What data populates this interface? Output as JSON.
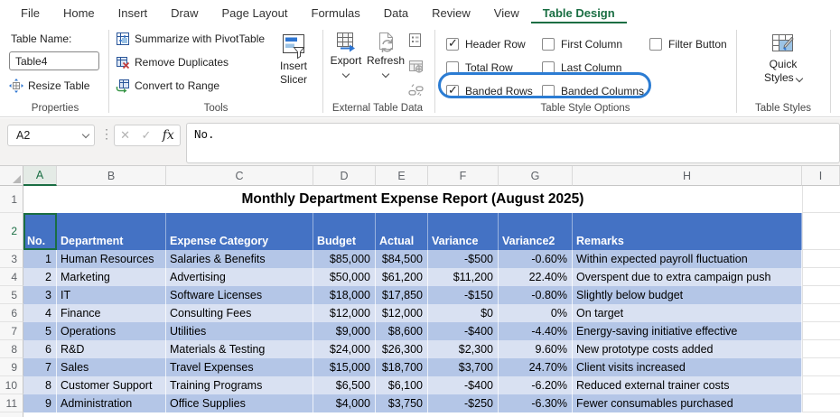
{
  "colors": {
    "accent_green": "#1a6e43",
    "header_fill": "#4472c4",
    "band_dark": "#b4c6e7",
    "band_light": "#d9e1f2",
    "highlight_ring": "#2b7cd3"
  },
  "ribbon": {
    "tabs": [
      {
        "label": "File",
        "active": false
      },
      {
        "label": "Home",
        "active": false
      },
      {
        "label": "Insert",
        "active": false
      },
      {
        "label": "Draw",
        "active": false
      },
      {
        "label": "Page Layout",
        "active": false
      },
      {
        "label": "Formulas",
        "active": false
      },
      {
        "label": "Data",
        "active": false
      },
      {
        "label": "Review",
        "active": false
      },
      {
        "label": "View",
        "active": false
      },
      {
        "label": "Table Design",
        "active": true
      }
    ],
    "properties": {
      "table_name_label": "Table Name:",
      "table_name_value": "Table4",
      "resize_table_label": "Resize Table",
      "group_label": "Properties"
    },
    "tools": {
      "items": [
        "Summarize with PivotTable",
        "Remove Duplicates",
        "Convert to Range"
      ],
      "insert_slicer_label": "Insert Slicer",
      "group_label": "Tools"
    },
    "external": {
      "export_label": "Export",
      "refresh_label": "Refresh",
      "group_label": "External Table Data"
    },
    "style_options": {
      "checkboxes": [
        {
          "label": "Header Row",
          "checked": true
        },
        {
          "label": "Total Row",
          "checked": false
        },
        {
          "label": "Banded Rows",
          "checked": true
        },
        {
          "label": "First Column",
          "checked": false
        },
        {
          "label": "Last Column",
          "checked": false
        },
        {
          "label": "Banded Columns",
          "checked": false
        },
        {
          "label": "Filter Button",
          "checked": false
        }
      ],
      "group_label": "Table Style Options"
    },
    "table_styles": {
      "quick_styles_line1": "Quick",
      "quick_styles_line2": "Styles",
      "group_label": "Table Styles"
    }
  },
  "formula_bar": {
    "name_box": "A2",
    "dots": "⋮",
    "cancel_glyph": "✕",
    "enter_glyph": "✓",
    "fx_glyph": "fx",
    "formula": "No."
  },
  "grid": {
    "column_letters": [
      "A",
      "B",
      "C",
      "D",
      "E",
      "F",
      "G",
      "H",
      "I"
    ],
    "selected_column": "A",
    "row1_num": "1",
    "row2_num": "2",
    "title": "Monthly Department Expense Report (August 2025)",
    "header_cells": [
      "No.",
      "Department",
      "Expense Category",
      "Budget",
      "Actual",
      "Variance",
      "Variance2",
      "Remarks"
    ],
    "rows": [
      {
        "num": "3",
        "cells": [
          "1",
          "Human Resources",
          "Salaries & Benefits",
          "$85,000",
          "$84,500",
          "-$500",
          "-0.60%",
          "Within expected payroll fluctuation"
        ]
      },
      {
        "num": "4",
        "cells": [
          "2",
          "Marketing",
          "Advertising",
          "$50,000",
          "$61,200",
          "$11,200",
          "22.40%",
          "Overspent due to extra campaign push"
        ]
      },
      {
        "num": "5",
        "cells": [
          "3",
          "IT",
          "Software Licenses",
          "$18,000",
          "$17,850",
          "-$150",
          "-0.80%",
          "Slightly below budget"
        ]
      },
      {
        "num": "6",
        "cells": [
          "4",
          "Finance",
          "Consulting Fees",
          "$12,000",
          "$12,000",
          "$0",
          "0%",
          "On target"
        ]
      },
      {
        "num": "7",
        "cells": [
          "5",
          "Operations",
          "Utilities",
          "$9,000",
          "$8,600",
          "-$400",
          "-4.40%",
          "Energy-saving initiative effective"
        ]
      },
      {
        "num": "8",
        "cells": [
          "6",
          "R&D",
          "Materials & Testing",
          "$24,000",
          "$26,300",
          "$2,300",
          "9.60%",
          "New prototype costs added"
        ]
      },
      {
        "num": "9",
        "cells": [
          "7",
          "Sales",
          "Travel Expenses",
          "$15,000",
          "$18,700",
          "$3,700",
          "24.70%",
          "Client visits increased"
        ]
      },
      {
        "num": "10",
        "cells": [
          "8",
          "Customer Support",
          "Training Programs",
          "$6,500",
          "$6,100",
          "-$400",
          "-6.20%",
          "Reduced external trainer costs"
        ]
      },
      {
        "num": "11",
        "cells": [
          "9",
          "Administration",
          "Office Supplies",
          "$4,000",
          "$3,750",
          "-$250",
          "-6.30%",
          "Fewer consumables purchased"
        ]
      }
    ]
  }
}
